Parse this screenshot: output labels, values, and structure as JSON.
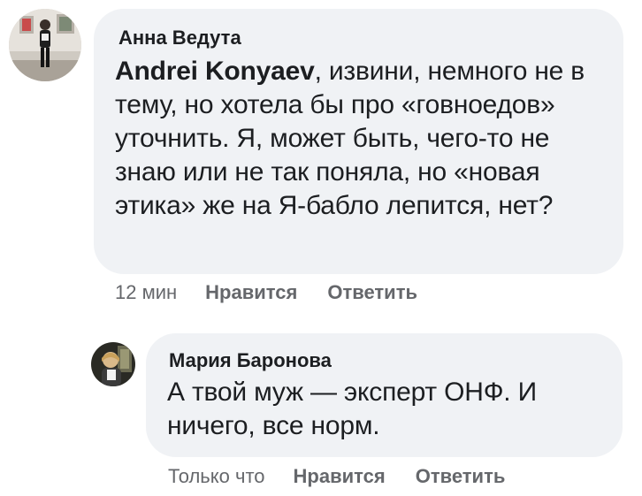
{
  "comments": [
    {
      "author": "Анна Ведута",
      "mention": "Andrei Konyaev",
      "text": ", извини, немного не в тему, но хотела бы про «говноедов» уточнить. Я, может быть, чего-то не знаю или не так поняла, но «новая этика» же на Я-бабло лепится, нет?",
      "timestamp": "12 мин",
      "like_label": "Нравится",
      "reply_label": "Ответить",
      "avatar_icon": "user-avatar-photo"
    },
    {
      "author": "Мария Баронова",
      "text": "А твой муж — эксперт ОНФ. И ничего, все норм.",
      "timestamp": "Только что",
      "like_label": "Нравится",
      "reply_label": "Ответить",
      "avatar_icon": "user-avatar-photo"
    }
  ],
  "colors": {
    "bubble_bg": "#f0f2f5",
    "text": "#1c1e21",
    "meta_text": "#65676b"
  }
}
